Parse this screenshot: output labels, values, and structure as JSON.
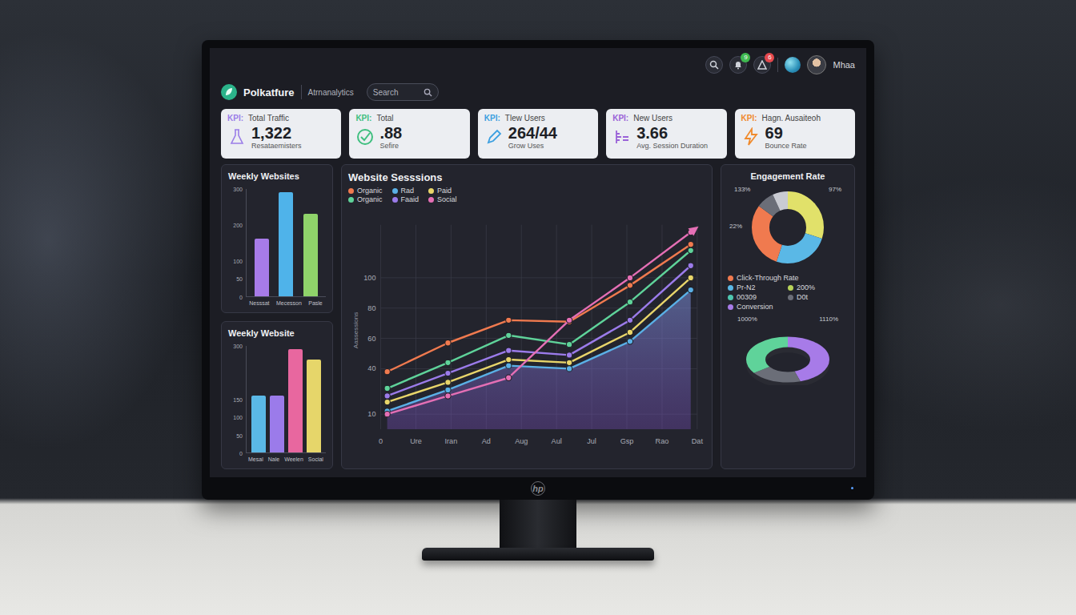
{
  "topbar": {
    "notifications": [
      {
        "badge": "9",
        "color": "#3fb950"
      },
      {
        "badge": "6",
        "color": "#e5484d"
      }
    ],
    "user": {
      "name": "Mhaa"
    }
  },
  "header": {
    "logo": "Polkatfure",
    "section": "Atrnanalytics",
    "search": {
      "placeholder": "Search"
    }
  },
  "kpis": [
    {
      "prefix": "KPI:",
      "label": "Total Traffic",
      "value": "1,322",
      "caption": "Resataemisters",
      "color": "#9a7de8"
    },
    {
      "prefix": "KPI:",
      "label": "Total",
      "value": ".88",
      "caption": "Sefire",
      "color": "#3fbf7f"
    },
    {
      "prefix": "KPI:",
      "label": "Tlew Users",
      "value": "264/44",
      "caption": "Grow Uses",
      "color": "#3b9fe0"
    },
    {
      "prefix": "KPI:",
      "label": "New Users",
      "value": "3.66",
      "caption": "Avg. Session Duration",
      "color": "#9a62d8"
    },
    {
      "prefix": "KPI:",
      "label": "Hagn. Ausaiteoh",
      "value": "69",
      "caption": "Bounce Rate",
      "color": "#f08a2c"
    }
  ],
  "bar_charts": [
    {
      "title": "Weekly Websites",
      "max": 300,
      "ticks": [
        "300",
        "200",
        "100",
        "50",
        "0"
      ],
      "bars": [
        {
          "label": "Nesssat",
          "value": 160,
          "color": "#a77be8"
        },
        {
          "label": "Mecesson",
          "value": 290,
          "color": "#4fb3ea"
        },
        {
          "label": "Pasle",
          "value": 230,
          "color": "#8fd36a"
        }
      ]
    },
    {
      "title": "Weekly Website",
      "max": 300,
      "ticks": [
        "300",
        "150",
        "100",
        "50",
        "0"
      ],
      "bars": [
        {
          "label": "Mesal",
          "value": 160,
          "color": "#5ab8e6"
        },
        {
          "label": "Nale",
          "value": 160,
          "color": "#9b7bea"
        },
        {
          "label": "Weelen",
          "value": 290,
          "color": "#e8679f"
        },
        {
          "label": "Social",
          "value": 260,
          "color": "#e6d66a"
        }
      ]
    }
  ],
  "sessions": {
    "title": "Website Sesssions",
    "y_label": "Aassessions",
    "max": 135,
    "ticks": [
      "100",
      "80",
      "60",
      "40",
      "10"
    ],
    "x_labels": [
      "0",
      "Ure",
      "Iran",
      "Ad",
      "Aug",
      "Aul",
      "Jul",
      "Gsp",
      "Rao",
      "Dat"
    ],
    "series": [
      {
        "name": "Organic",
        "color": "#f07a4f",
        "values": [
          38,
          57,
          72,
          71,
          95,
          122
        ],
        "filled": false,
        "arrow": false
      },
      {
        "name": "Rad",
        "color": "#5ab0e6",
        "values": [
          12,
          26,
          42,
          40,
          58,
          92
        ],
        "filled": true,
        "arrow": false
      },
      {
        "name": "Paid",
        "color": "#e8d56a",
        "values": [
          18,
          31,
          46,
          44,
          64,
          100
        ],
        "filled": false,
        "arrow": false
      },
      {
        "name": "Organic",
        "color": "#5fd39a",
        "values": [
          27,
          44,
          62,
          56,
          84,
          118
        ],
        "filled": false,
        "arrow": false
      },
      {
        "name": "Faaid",
        "color": "#9b7bea",
        "values": [
          22,
          37,
          52,
          49,
          72,
          108
        ],
        "filled": false,
        "arrow": false
      },
      {
        "name": "Social",
        "color": "#e56fb5",
        "values": [
          10,
          22,
          34,
          72,
          100,
          130
        ],
        "filled": false,
        "arrow": true
      }
    ]
  },
  "engagement": {
    "title": "Engagement Rate",
    "donut": {
      "labels": [
        "133%",
        "97%",
        "22%"
      ],
      "segments": [
        {
          "value": 0.3,
          "color": "#e1e16a"
        },
        {
          "value": 0.25,
          "color": "#5ab8e6"
        },
        {
          "value": 0.3,
          "color": "#f07a4f"
        },
        {
          "value": 0.08,
          "color": "#6b6e78"
        },
        {
          "value": 0.07,
          "color": "#c9cbd2"
        }
      ]
    },
    "legend": [
      {
        "label": "Click-Through Rate",
        "color": "#f07a4f"
      },
      {
        "label": "Pr-N2",
        "color": "#5ab8e6"
      },
      {
        "label": "200%",
        "color": "#b7d35a"
      },
      {
        "label": "00309",
        "color": "#4fc7b0"
      },
      {
        "label": "D0t",
        "color": "#6b6e78"
      },
      {
        "label": "Conversion",
        "color": "#a77be8"
      }
    ],
    "ring": {
      "labels": [
        "1000%",
        "1110%"
      ],
      "segments": [
        {
          "value": 0.45,
          "color": "#a77be8"
        },
        {
          "value": 0.2,
          "color": "#6b6e78"
        },
        {
          "value": 0.35,
          "color": "#5fd39a"
        }
      ]
    }
  },
  "monitor": {
    "brand": "hp"
  }
}
